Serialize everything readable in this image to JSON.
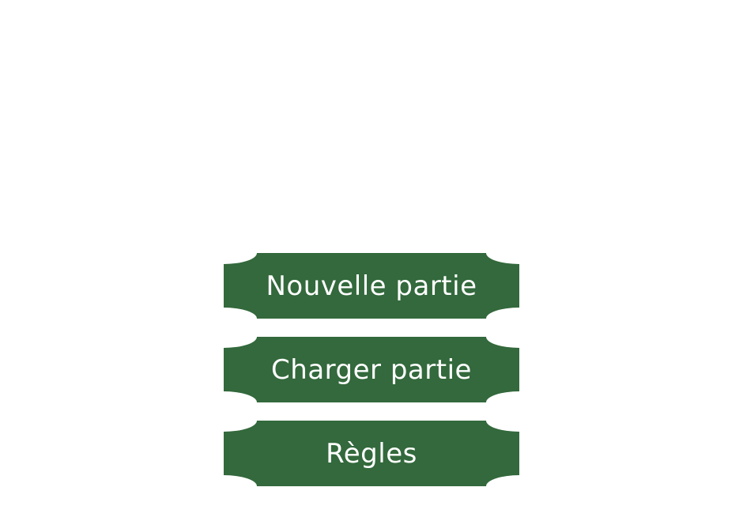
{
  "colors": {
    "background": "#ffffff",
    "button_fill": "#33693c",
    "button_text": "#ffffff"
  },
  "menu": {
    "new_game_label": "Nouvelle partie",
    "load_game_label": "Charger partie",
    "rules_label": "Règles"
  }
}
